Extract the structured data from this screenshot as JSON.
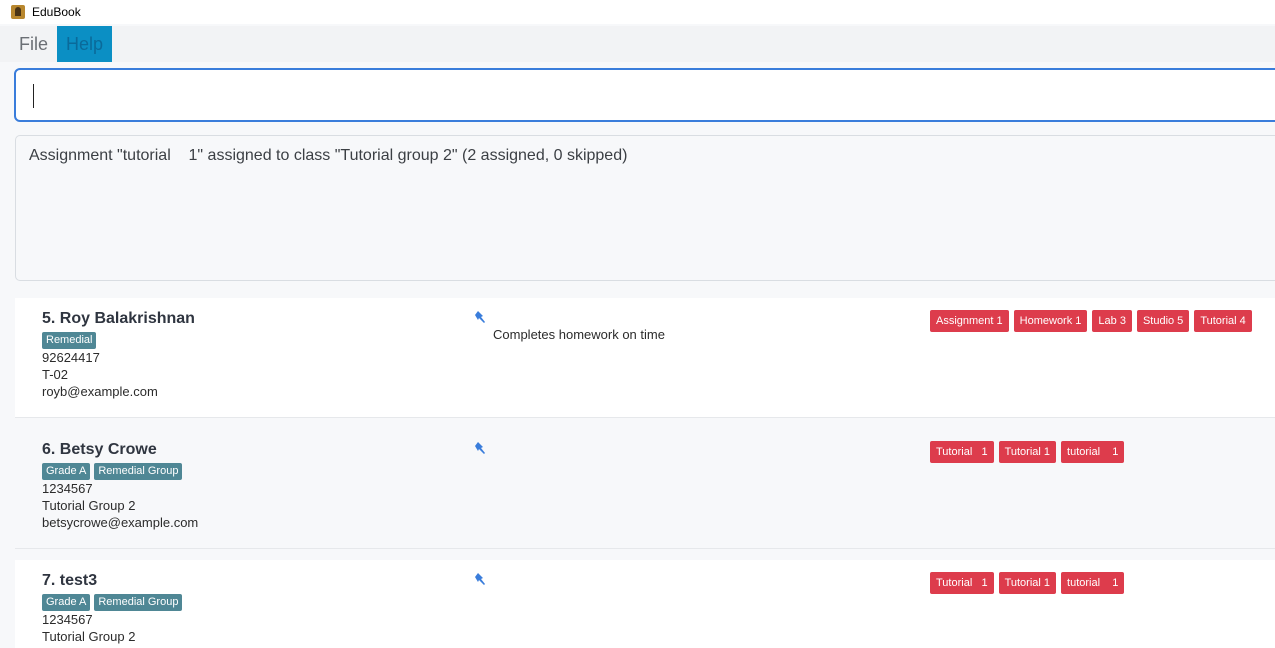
{
  "window": {
    "title": "EduBook"
  },
  "menu": {
    "file": "File",
    "help": "Help"
  },
  "command": {
    "value": ""
  },
  "result": {
    "text": "Assignment \"tutorial    1\" assigned to class \"Tutorial group 2\" (2 assigned, 0 skipped)"
  },
  "persons": [
    {
      "name": "5. Roy Balakrishnan",
      "tags": [
        "Remedial"
      ],
      "phone": "92624417",
      "class": "T-02",
      "email": "royb@example.com",
      "note": "Completes homework on time",
      "assignments": [
        "Assignment 1",
        "Homework 1",
        "Lab 3",
        "Studio 5",
        "Tutorial 4"
      ]
    },
    {
      "name": "6. Betsy Crowe",
      "tags": [
        "Grade A",
        "Remedial Group"
      ],
      "phone": "1234567",
      "class": "Tutorial Group 2",
      "email": "betsycrowe@example.com",
      "note": "",
      "assignments": [
        "Tutorial   1",
        "Tutorial 1",
        "tutorial    1"
      ]
    },
    {
      "name": "7. test3",
      "tags": [
        "Grade A",
        "Remedial Group"
      ],
      "phone": "1234567",
      "class": "Tutorial Group 2",
      "email": "",
      "note": "",
      "assignments": [
        "Tutorial   1",
        "Tutorial 1",
        "tutorial    1"
      ]
    }
  ],
  "colors": {
    "accent": "#3a7ddb",
    "tag": "#4f8795",
    "assignment": "#dd3c4c",
    "menu_active": "#0b8fc4",
    "pin": "#3a7ddb"
  },
  "icons": {
    "app": "edubook-app-icon",
    "pin": "pin-icon"
  }
}
